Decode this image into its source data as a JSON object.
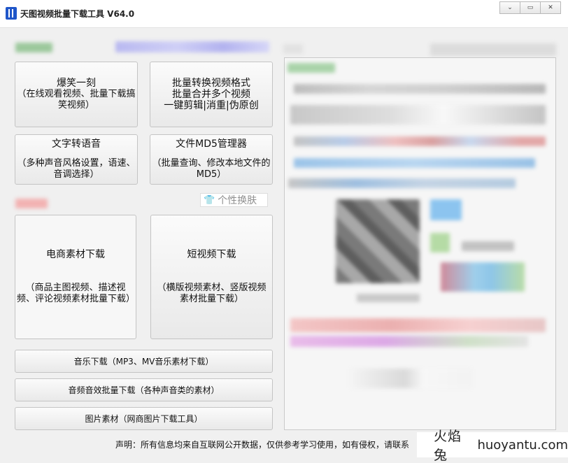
{
  "window": {
    "title": "天图视频批量下载工具 V64.0",
    "controls": [
      "⌄",
      "▭",
      "✕"
    ]
  },
  "buttons": {
    "joke": {
      "main": "爆笑一刻",
      "sub": "（在线观看视频、批量下载搞笑视频）"
    },
    "convert": {
      "main": "批量转换视频格式",
      "sub": "批量合并多个视频",
      "sub2": "一键剪辑|消重|伪原创"
    },
    "tts": {
      "main": "文字转语音",
      "sub": "（多种声音风格设置，语速、音调选择）"
    },
    "md5": {
      "main": "文件MD5管理器",
      "sub": "（批量查询、修改本地文件的MD5）"
    },
    "ecommerce": {
      "main": "电商素材下载",
      "sub": "（商品主图视频、描述视频、评论视频素材批量下载）"
    },
    "short_video": {
      "main": "短视频下载",
      "sub": "（横版视频素材、竖版视频素材批量下载）"
    },
    "music": {
      "label": "音乐下载（MP3、MV音乐素材下载）"
    },
    "sound": {
      "label": "音频音效批量下载（各种声音类的素材）"
    },
    "image": {
      "label": "图片素材（网商图片下载工具）"
    }
  },
  "skin": {
    "label": "个性换肤",
    "icon": "tshirt-icon"
  },
  "footer": {
    "statement": "声明：所有信息均来自互联网公开数据，仅供参考学习使用，如有侵权，请联系"
  },
  "watermark": {
    "cn": "火焰兔",
    "en": "huoyantu.com"
  }
}
